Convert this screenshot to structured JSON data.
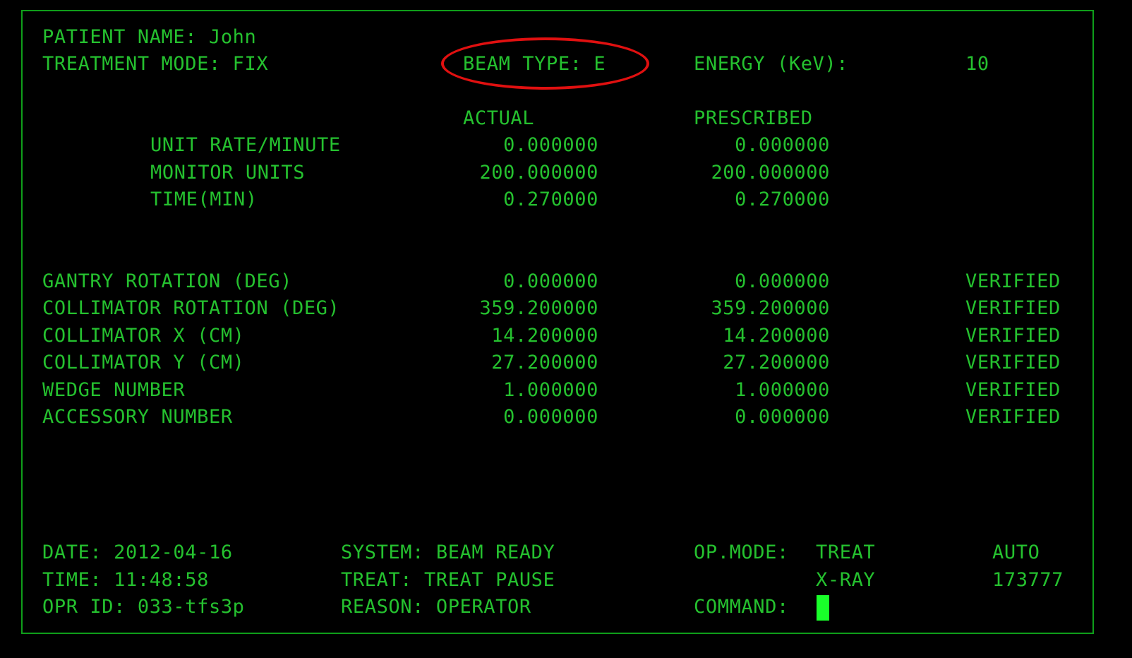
{
  "header": {
    "patient_name": "PATIENT NAME: John",
    "treatment_mode": "TREATMENT MODE: FIX",
    "beam_type": "BEAM TYPE: E",
    "energy_label": "ENERGY (KeV):",
    "energy_value": "10"
  },
  "columns": {
    "actual": "ACTUAL",
    "prescribed": "PRESCRIBED"
  },
  "rate_rows": [
    {
      "label": "UNIT RATE/MINUTE",
      "actual": "0.000000",
      "prescribed": "0.000000"
    },
    {
      "label": "MONITOR UNITS",
      "actual": "200.000000",
      "prescribed": "200.000000"
    },
    {
      "label": "TIME(MIN)",
      "actual": "0.270000",
      "prescribed": "0.270000"
    }
  ],
  "param_rows": [
    {
      "label": "GANTRY ROTATION (DEG)",
      "actual": "0.000000",
      "prescribed": "0.000000",
      "status": "VERIFIED"
    },
    {
      "label": "COLLIMATOR ROTATION (DEG)",
      "actual": "359.200000",
      "prescribed": "359.200000",
      "status": "VERIFIED"
    },
    {
      "label": "COLLIMATOR X (CM)",
      "actual": "14.200000",
      "prescribed": "14.200000",
      "status": "VERIFIED"
    },
    {
      "label": "COLLIMATOR Y (CM)",
      "actual": "27.200000",
      "prescribed": "27.200000",
      "status": "VERIFIED"
    },
    {
      "label": "WEDGE NUMBER",
      "actual": "1.000000",
      "prescribed": "1.000000",
      "status": "VERIFIED"
    },
    {
      "label": "ACCESSORY NUMBER",
      "actual": "0.000000",
      "prescribed": "0.000000",
      "status": "VERIFIED"
    }
  ],
  "footer": {
    "date": "DATE: 2012-04-16",
    "time": "TIME: 11:48:58",
    "opr_id": "OPR ID: 033-tfs3p",
    "system": "SYSTEM: BEAM READY",
    "treat": "TREAT: TREAT PAUSE",
    "reason": "REASON: OPERATOR",
    "op_mode_label": "OP.MODE:",
    "op_mode_value": "TREAT",
    "xray": "X-RAY",
    "command_label": "COMMAND:",
    "auto": "AUTO",
    "code": "173777"
  },
  "colors": {
    "text": "#25c12f",
    "border": "#0f9e1a",
    "highlight": "#e01010",
    "cursor": "#19ff2a",
    "background": "#000000"
  }
}
